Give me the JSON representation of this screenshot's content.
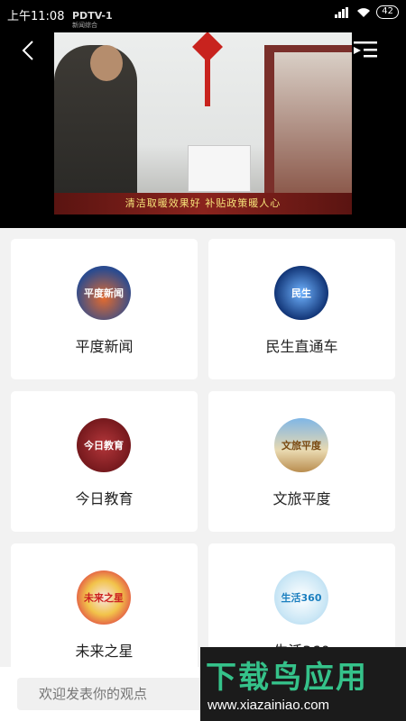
{
  "status_bar": {
    "time": "上午11:08",
    "battery": "42"
  },
  "player": {
    "channel_logo": "PDTV-1",
    "channel_sub": "新闻综合",
    "caption": "清洁取暖效果好 补贴政策暖人心"
  },
  "columns": [
    {
      "name": "平度新闻",
      "logo_text": "平度新闻",
      "color_a": "#c0392b",
      "color_b": "#2b4b8f"
    },
    {
      "name": "民生直通车",
      "logo_text": "民生",
      "color_a": "#1f5fb8",
      "color_b": "#0b2c6d"
    },
    {
      "name": "今日教育",
      "logo_text": "今日教育",
      "color_a": "#a0262a",
      "color_b": "#6d1519"
    },
    {
      "name": "文旅平度",
      "logo_text": "文旅平度",
      "color_a": "#4f8fc7",
      "color_b": "#c5a05f"
    },
    {
      "name": "未来之星",
      "logo_text": "未来之星",
      "color_a": "#e14b45",
      "color_b": "#f2c34a"
    },
    {
      "name": "生活360",
      "logo_text": "生活360",
      "color_a": "#a7d3ee",
      "color_b": "#e8f4fb"
    }
  ],
  "comment": {
    "placeholder": "欢迎发表你的观点"
  },
  "watermark": {
    "title": "下载鸟应用",
    "url": "www.xiazainiao.com"
  }
}
